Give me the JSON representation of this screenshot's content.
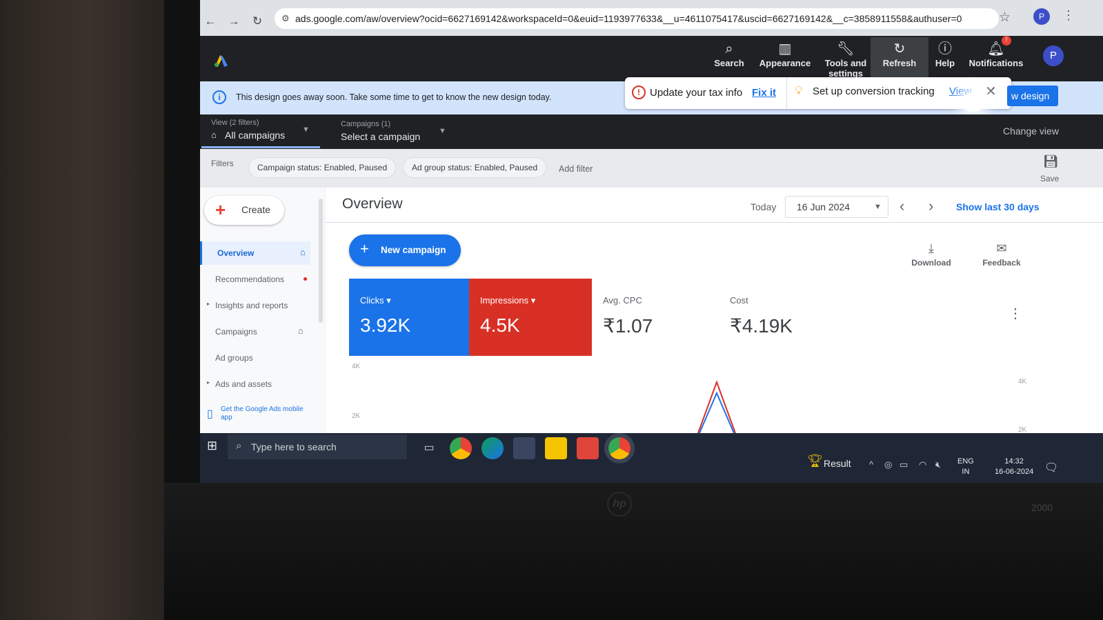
{
  "browser": {
    "url": "ads.google.com/aw/overview?ocid=6627169142&workspaceId=0&euid=1193977633&__u=4611075417&uscid=6627169142&__c=3858911558&authuser=0",
    "profile_initial": "P"
  },
  "header": {
    "items": [
      {
        "label": "Search",
        "icon": "search-icon"
      },
      {
        "label": "Appearance",
        "icon": "appearance-icon"
      },
      {
        "label": "Tools and settings",
        "icon": "wrench-icon"
      },
      {
        "label": "Refresh",
        "icon": "refresh-icon"
      },
      {
        "label": "Help",
        "icon": "help-icon"
      },
      {
        "label": "Notifications",
        "icon": "bell-icon"
      }
    ],
    "notification_badge": "!",
    "account_initial": "P"
  },
  "banner": {
    "text": "This design goes away soon. Take some time to get to know the new design today.",
    "tax_text": "Update your tax info",
    "tax_link": "Fix it",
    "conversion_text": "Set up conversion tracking",
    "conversion_link": "View",
    "new_design_button": "w design"
  },
  "campaign_bar": {
    "view_label": "View (2 filters)",
    "view_value": "All campaigns",
    "campaigns_label": "Campaigns (1)",
    "campaigns_value": "Select a campaign",
    "change_view": "Change view"
  },
  "filters": {
    "label": "Filters",
    "chips": [
      "Campaign status: Enabled, Paused",
      "Ad group status: Enabled, Paused"
    ],
    "add_filter": "Add filter",
    "save_label": "Save"
  },
  "sidebar": {
    "create_label": "Create",
    "items": [
      {
        "label": "Overview",
        "marker": "home"
      },
      {
        "label": "Recommendations",
        "marker": "dot"
      },
      {
        "label": "Insights and reports",
        "marker": "expand"
      },
      {
        "label": "Campaigns",
        "marker": "home"
      },
      {
        "label": "Ad groups",
        "marker": ""
      },
      {
        "label": "Ads and assets",
        "marker": "expand"
      }
    ],
    "app_promo": "Get the Google Ads mobile app"
  },
  "main": {
    "title": "Overview",
    "today_label": "Today",
    "date": "16 Jun 2024",
    "show_last_30": "Show last 30 days",
    "new_campaign": "New campaign",
    "download": "Download",
    "feedback": "Feedback",
    "metrics": [
      {
        "label": "Clicks",
        "value": "3.92K",
        "color": "#1a73e8"
      },
      {
        "label": "Impressions",
        "value": "4.5K",
        "color": "#d93025"
      },
      {
        "label": "Avg. CPC",
        "value": "₹1.07"
      },
      {
        "label": "Cost",
        "value": "₹4.19K"
      }
    ]
  },
  "chart_data": {
    "type": "line",
    "y_left_ticks": [
      "4K",
      "2K"
    ],
    "y_right_ticks": [
      "4K",
      "2K"
    ],
    "series": [
      {
        "name": "Clicks",
        "color": "#1a73e8",
        "peak": 3920
      },
      {
        "name": "Impressions",
        "color": "#d93025",
        "peak": 4500
      }
    ]
  },
  "taskbar": {
    "search_placeholder": "Type here to search",
    "result_label": "Result",
    "lang_line1": "ENG",
    "lang_line2": "IN",
    "time": "14:32",
    "date": "16-06-2024"
  },
  "device": {
    "model": "2000",
    "logo": "hp"
  }
}
